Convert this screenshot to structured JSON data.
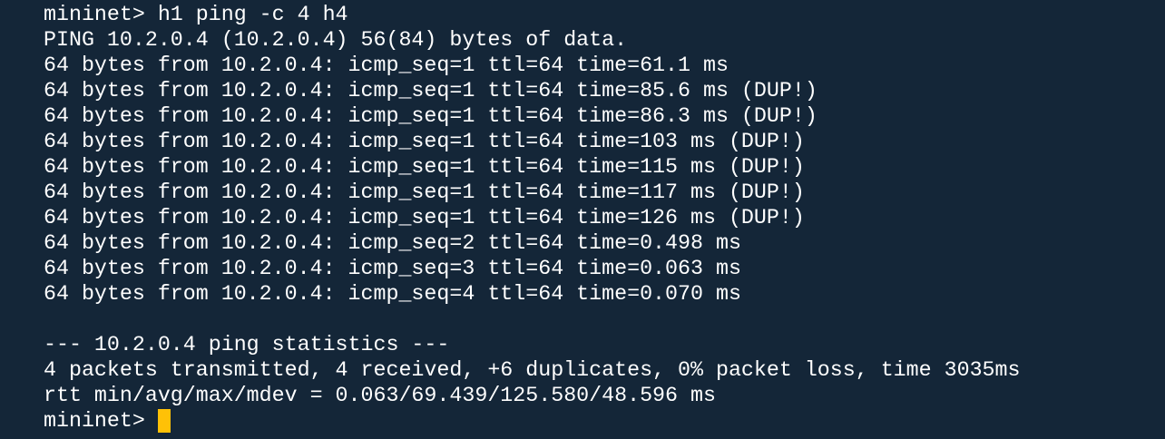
{
  "terminal": {
    "background_color": "#142638",
    "text_color": "#ffffff",
    "cursor_color": "#ffc107",
    "lines": [
      "mininet> h1 ping -c 4 h4",
      "PING 10.2.0.4 (10.2.0.4) 56(84) bytes of data.",
      "64 bytes from 10.2.0.4: icmp_seq=1 ttl=64 time=61.1 ms",
      "64 bytes from 10.2.0.4: icmp_seq=1 ttl=64 time=85.6 ms (DUP!)",
      "64 bytes from 10.2.0.4: icmp_seq=1 ttl=64 time=86.3 ms (DUP!)",
      "64 bytes from 10.2.0.4: icmp_seq=1 ttl=64 time=103 ms (DUP!)",
      "64 bytes from 10.2.0.4: icmp_seq=1 ttl=64 time=115 ms (DUP!)",
      "64 bytes from 10.2.0.4: icmp_seq=1 ttl=64 time=117 ms (DUP!)",
      "64 bytes from 10.2.0.4: icmp_seq=1 ttl=64 time=126 ms (DUP!)",
      "64 bytes from 10.2.0.4: icmp_seq=2 ttl=64 time=0.498 ms",
      "64 bytes from 10.2.0.4: icmp_seq=3 ttl=64 time=0.063 ms",
      "64 bytes from 10.2.0.4: icmp_seq=4 ttl=64 time=0.070 ms",
      "",
      "--- 10.2.0.4 ping statistics ---",
      "4 packets transmitted, 4 received, +6 duplicates, 0% packet loss, time 3035ms",
      "rtt min/avg/max/mdev = 0.063/69.439/125.580/48.596 ms"
    ],
    "prompt": "mininet>"
  }
}
